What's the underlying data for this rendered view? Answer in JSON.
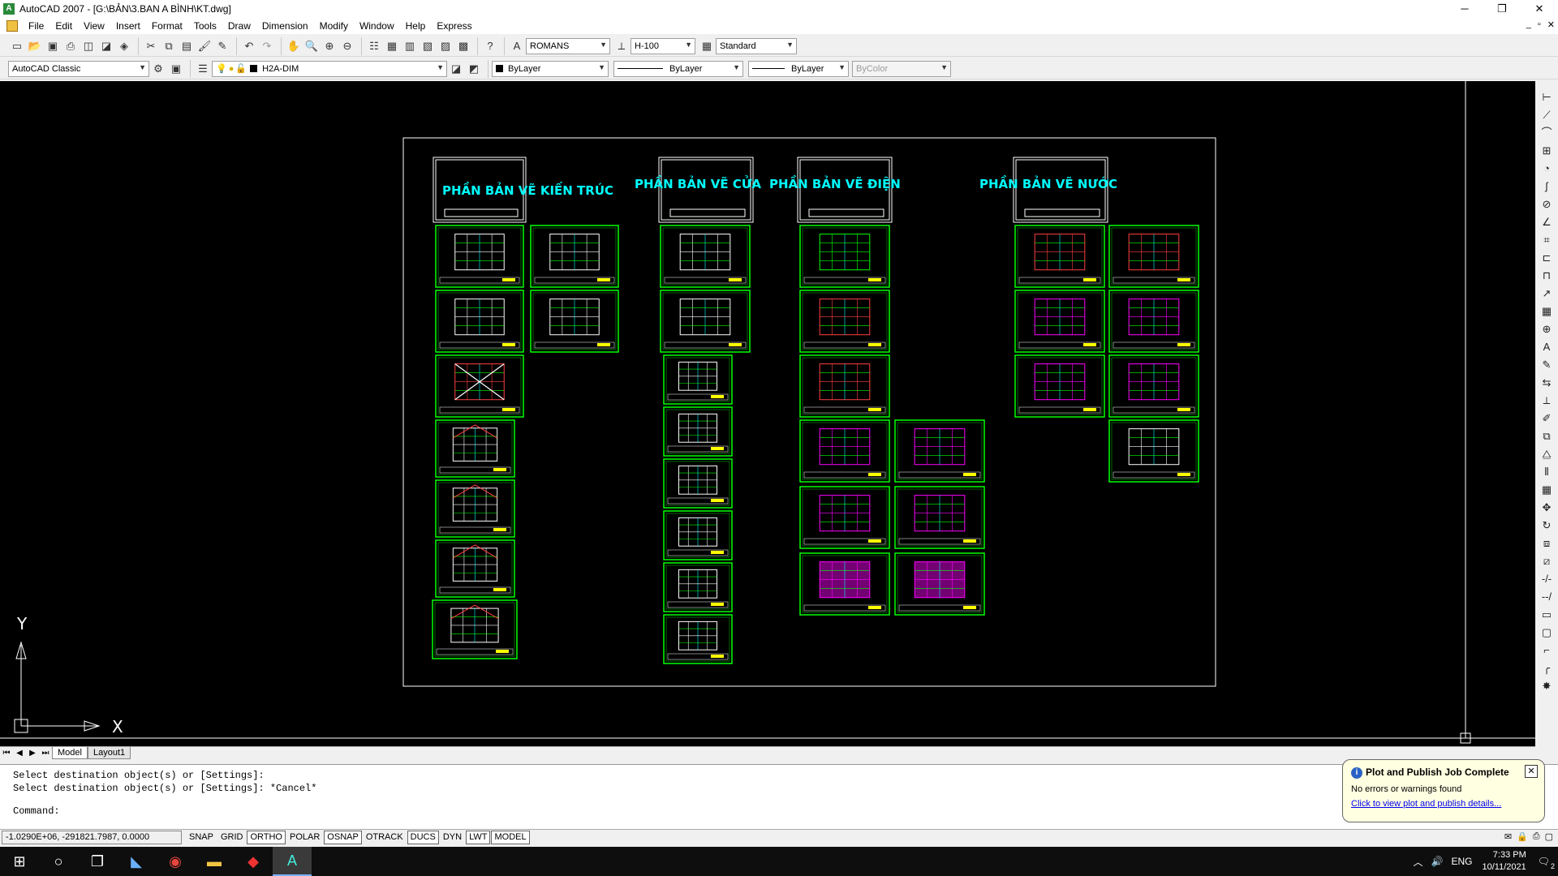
{
  "window": {
    "title": "AutoCAD 2007 - [G:\\BẢN\\3.BAN  A BÌNH\\KT.dwg]",
    "minimize": "─",
    "restore": "❐",
    "close": "✕"
  },
  "menu": {
    "items": [
      "File",
      "Edit",
      "View",
      "Insert",
      "Format",
      "Tools",
      "Draw",
      "Dimension",
      "Modify",
      "Window",
      "Help",
      "Express"
    ],
    "mdi_minimize": "_",
    "mdi_restore": "▫",
    "mdi_close": "✕"
  },
  "toolbar1": {
    "text_style": "ROMANS",
    "dim_style": "H-100",
    "table_style": "Standard"
  },
  "toolbar2": {
    "workspace": "AutoCAD Classic",
    "layer": "H2A-DIM",
    "color": "ByLayer",
    "linetype": "ByLayer",
    "lineweight": "ByLayer",
    "plotstyle": "ByColor"
  },
  "drawing": {
    "sections": [
      {
        "label": "PHẦN BẢN VẼ KIẾN TRÚC"
      },
      {
        "label": "PHẦN BẢN VẼ CỬA"
      },
      {
        "label": "PHẦN BẢN VẼ ĐIỆN"
      },
      {
        "label": "PHẦN BẢN VẼ NƯỚC"
      }
    ],
    "ucs_y": "Y",
    "ucs_x": "X"
  },
  "tabs": {
    "model": "Model",
    "layout1": "Layout1"
  },
  "command": {
    "history": [
      "Select destination object(s) or [Settings]:",
      "Select destination object(s) or [Settings]: *Cancel*"
    ],
    "prompt": "Command:"
  },
  "status": {
    "coords": "-1.0290E+06, -291821.7987, 0.0000",
    "buttons": [
      {
        "label": "SNAP",
        "on": false
      },
      {
        "label": "GRID",
        "on": false
      },
      {
        "label": "ORTHO",
        "on": true
      },
      {
        "label": "POLAR",
        "on": false
      },
      {
        "label": "OSNAP",
        "on": true
      },
      {
        "label": "OTRACK",
        "on": false
      },
      {
        "label": "DUCS",
        "on": true
      },
      {
        "label": "DYN",
        "on": false
      },
      {
        "label": "LWT",
        "on": true
      },
      {
        "label": "MODEL",
        "on": true
      }
    ]
  },
  "notification": {
    "title": "Plot and Publish Job Complete",
    "message": "No errors or warnings found",
    "link": "Click to view plot and publish details..."
  },
  "taskbar": {
    "lang": "ENG",
    "time": "7:33 PM",
    "date": "10/11/2021",
    "notif_count": "2"
  },
  "colors": {
    "canvas_bg": "#000000",
    "sheet_frame": "#00ff00",
    "section_title": "#00ffff",
    "border": "#ffffff"
  }
}
